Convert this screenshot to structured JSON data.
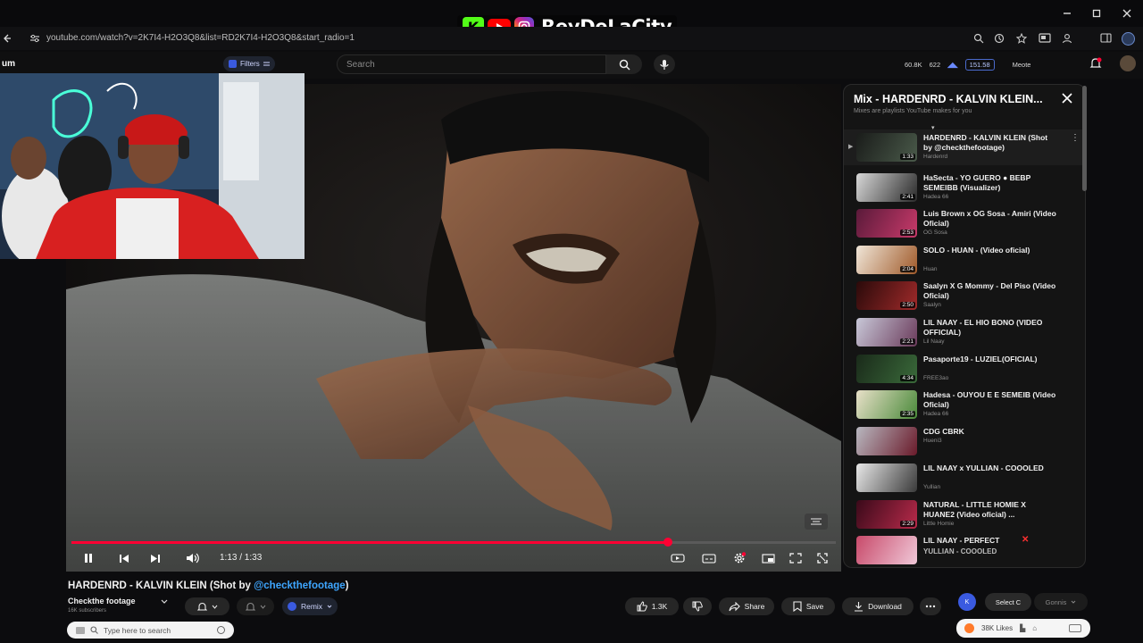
{
  "browser": {
    "url": "youtube.com/watch?v=2K7I4-H2O3Q8&list=RD2K7I4-H2O3Q8&start_radio=1",
    "overlay_name": "ReyDeLaCity"
  },
  "header": {
    "logo_text": "um",
    "filters_label": "Filters",
    "search_placeholder": "Search",
    "stats": [
      "60.8K",
      "622",
      "151.58"
    ],
    "user_label": "Meote"
  },
  "player": {
    "time": "1:13 / 1:33",
    "progress_fraction": 0.78
  },
  "video": {
    "title": "HARDENRD - KALVIN KLEIN (Shot by ",
    "title_link": "@checkthefootage",
    "title_end": ")",
    "channel": "Checkthe footage",
    "channel_sub": "16K subscribers",
    "remix_label": "Remix",
    "likes": "1.3K",
    "share_label": "Share",
    "save_label": "Save",
    "download_label": "Download",
    "sort_label": "Select C",
    "sort_value": "Gonnis"
  },
  "playlist": {
    "title": "Mix - HARDENRD - KALVIN KLEIN...",
    "subtitle": "Mixes are playlists YouTube makes for you",
    "items": [
      {
        "title": "HARDENRD - KALVIN KLEIN (Shot by @checkthefootage)",
        "channel": "Hardenrd",
        "duration": "1:33",
        "colors": [
          "#1a1c1a",
          "#4a5a4a"
        ]
      },
      {
        "title": "HaSecta - YO GUERO ● BEBP SEMEIBB (Visualizer)",
        "channel": "Hadea 66",
        "duration": "2:41",
        "colors": [
          "#d8d8d8",
          "#2a2a2a"
        ]
      },
      {
        "title": "Luis Brown x OG Sosa - Amiri (Video Oficial)",
        "channel": "OG Sosa",
        "duration": "2:53",
        "colors": [
          "#5a1a3a",
          "#c83a6a"
        ]
      },
      {
        "title": "SOLO - HUAN - (Video oficial)",
        "channel": "Huan",
        "duration": "2:04",
        "colors": [
          "#f0e6d8",
          "#a05a2a"
        ]
      },
      {
        "title": "Saalyn X G Mommy - Del Piso (Video Oficial)",
        "channel": "Saalyn",
        "duration": "2:50",
        "colors": [
          "#2a0a0a",
          "#a02a2a"
        ]
      },
      {
        "title": "LIL NAAY - EL HIO BONO (VIDEO OFFICIAL)",
        "channel": "Lil Naay",
        "duration": "2:21",
        "colors": [
          "#c8c8d8",
          "#6a3a5a"
        ]
      },
      {
        "title": "Pasaporte19 - LUZIEL(OFICIAL)",
        "channel": "FREE3ao",
        "duration": "4:34",
        "colors": [
          "#1a2a1a",
          "#3a6a3a"
        ]
      },
      {
        "title": "Hadesa - OUYOU E E SEMEIB (Video Oficial)",
        "channel": "Hadea 66",
        "duration": "2:35",
        "colors": [
          "#e8e0c8",
          "#4a8a3a"
        ]
      },
      {
        "title": "CDG CBRK",
        "channel": "Hueni3",
        "duration": "",
        "colors": [
          "#b8b8c0",
          "#6a1a2a"
        ]
      },
      {
        "title": "LIL NAAY x YULLIAN - COOOLED",
        "channel": "Yullian",
        "duration": "",
        "colors": [
          "#e8e8e8",
          "#3a3a3a"
        ]
      },
      {
        "title": "NATURAL - LITTLE HOMIE X HUANE2 (Video oficial) ...",
        "channel": "Little Homie",
        "duration": "2:29",
        "colors": [
          "#3a0a1a",
          "#b82a4a"
        ]
      },
      {
        "title": "LIL NAAY - PERFECT",
        "channel": "",
        "duration": "",
        "colors": [
          "#c84a6a",
          "#f0c8d8"
        ]
      }
    ],
    "last_item_sub": "YULLIAN - COOOLED"
  },
  "footer": {
    "search_placeholder": "Type here to search",
    "toast_text": "38K Likes"
  }
}
